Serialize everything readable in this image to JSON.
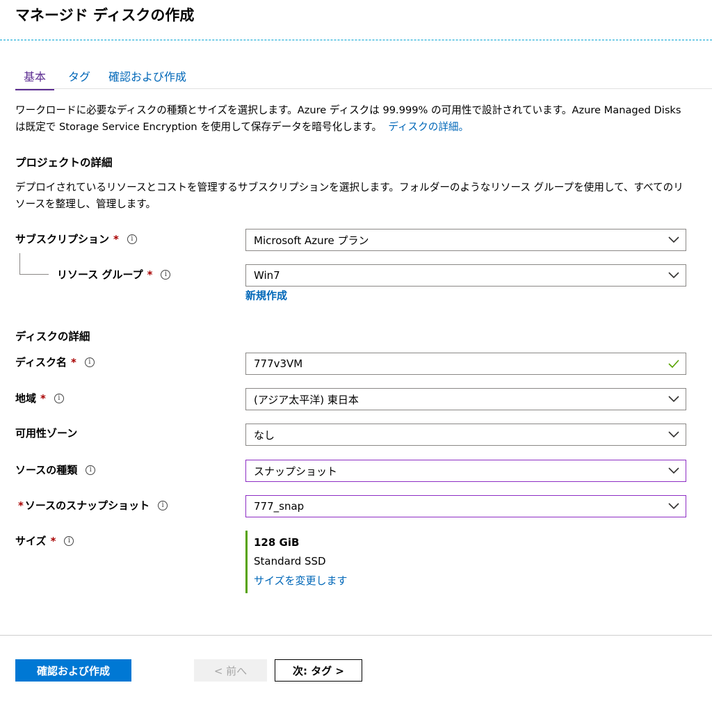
{
  "page": {
    "title": "マネージド ディスクの作成"
  },
  "tabs": [
    {
      "label": "基本",
      "active": true
    },
    {
      "label": "タグ",
      "active": false
    },
    {
      "label": "確認および作成",
      "active": false
    }
  ],
  "intro": {
    "text": "ワークロードに必要なディスクの種類とサイズを選択します。Azure ディスクは 99.999% の可用性で設計されています。Azure Managed Disks は既定で Storage Service Encryption を使用して保存データを暗号化します。",
    "link": "ディスクの詳細。"
  },
  "project": {
    "heading": "プロジェクトの詳細",
    "description": "デプロイされているリソースとコストを管理するサブスクリプションを選択します。フォルダーのようなリソース グループを使用して、すべてのリソースを整理し、管理します。",
    "subscription_label": "サブスクリプション",
    "subscription_value": "Microsoft Azure プラン",
    "resource_group_label": "リソース グループ",
    "resource_group_value": "Win7",
    "new_link": "新規作成"
  },
  "disk": {
    "heading": "ディスクの詳細",
    "name_label": "ディスク名",
    "name_value": "777v3VM",
    "region_label": "地域",
    "region_value": "(アジア太平洋) 東日本",
    "zone_label": "可用性ゾーン",
    "zone_value": "なし",
    "source_type_label": "ソースの種類",
    "source_type_value": "スナップショット",
    "source_snapshot_label": "ソースのスナップショット",
    "source_snapshot_value": "777_snap",
    "size_label": "サイズ",
    "size_value": "128 GiB",
    "size_type": "Standard SSD",
    "size_change_link": "サイズを変更します"
  },
  "footer": {
    "review_create": "確認および作成",
    "previous": "< 前へ",
    "next": "次: タグ >"
  },
  "symbols": {
    "required": "*",
    "info": "i"
  },
  "colors": {
    "accent": "#0078d4",
    "link": "#0067b8",
    "active_tab": "#5c2d91",
    "required": "#a80000",
    "valid": "#57a300",
    "focus_border": "#8d2dc4"
  }
}
